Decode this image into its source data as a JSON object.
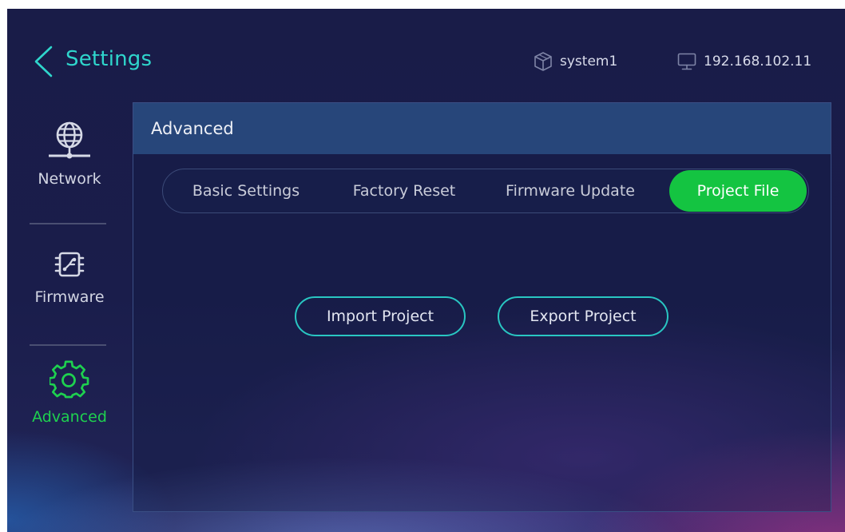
{
  "header": {
    "title": "Settings",
    "device_name": "system1",
    "ip_address": "192.168.102.11"
  },
  "sidebar": {
    "items": [
      {
        "label": "Network",
        "icon": "globe-network-icon",
        "active": false
      },
      {
        "label": "Firmware",
        "icon": "chip-icon",
        "active": false
      },
      {
        "label": "Advanced",
        "icon": "gear-icon",
        "active": true
      }
    ]
  },
  "panel": {
    "title": "Advanced",
    "tabs": [
      {
        "label": "Basic Settings",
        "active": false
      },
      {
        "label": "Factory Reset",
        "active": false
      },
      {
        "label": "Firmware Update",
        "active": false
      },
      {
        "label": "Project File",
        "active": true
      }
    ],
    "actions": {
      "import_label": "Import Project",
      "export_label": "Export Project"
    }
  },
  "colors": {
    "accent_teal": "#2fd6cc",
    "active_green": "#14c441",
    "panel_header": "#27467a",
    "background": "#191c48"
  }
}
